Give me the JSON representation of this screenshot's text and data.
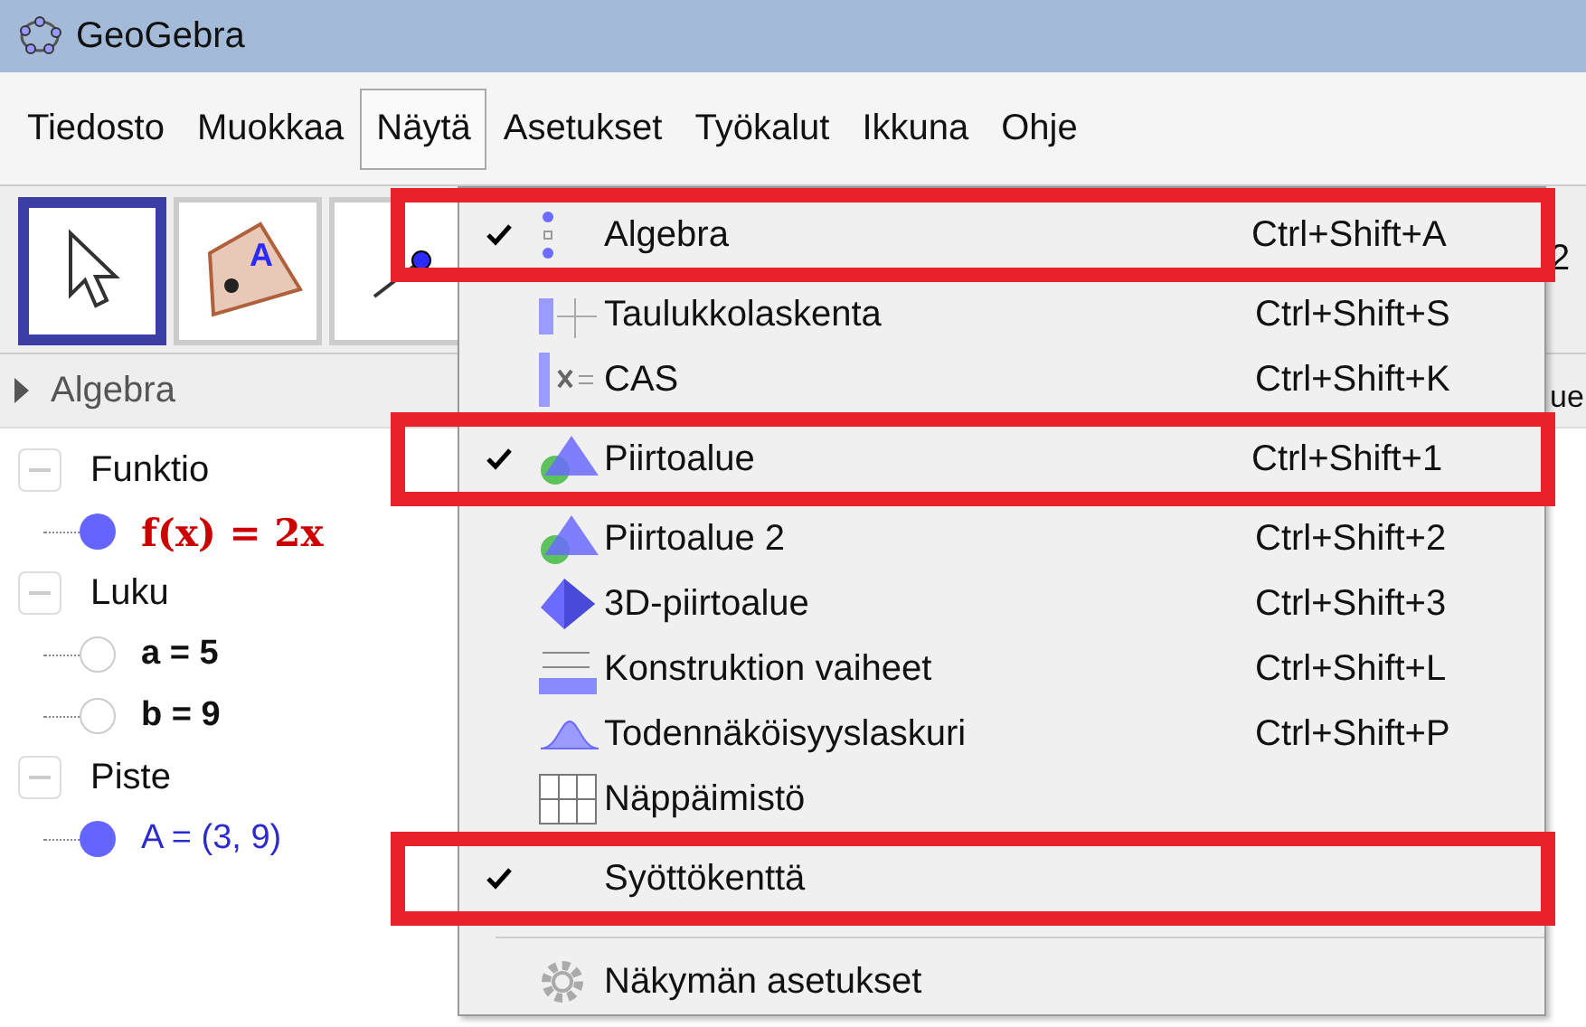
{
  "window": {
    "title": "GeoGebra"
  },
  "menu_bar": [
    {
      "label": "Tiedosto",
      "selected": false
    },
    {
      "label": "Muokkaa",
      "selected": false
    },
    {
      "label": "Näytä",
      "selected": true
    },
    {
      "label": "Asetukset",
      "selected": false
    },
    {
      "label": "Työkalut",
      "selected": false
    },
    {
      "label": "Ikkuna",
      "selected": false
    },
    {
      "label": "Ohje",
      "selected": false
    }
  ],
  "toolbar": {
    "tools": [
      {
        "kind": "move",
        "selected": true
      },
      {
        "kind": "polygon",
        "selected": false,
        "point_label": "A"
      },
      {
        "kind": "line",
        "selected": false
      }
    ]
  },
  "algebra_view": {
    "title": "Algebra",
    "groups": [
      {
        "label": "Funktio",
        "expanded": true,
        "children": [
          {
            "label": "f(x) = 2x",
            "kind": "function",
            "shown": true
          }
        ]
      },
      {
        "label": "Luku",
        "expanded": true,
        "children": [
          {
            "label": "a = 5",
            "kind": "number",
            "shown": false
          },
          {
            "label": "b = 9",
            "kind": "number",
            "shown": false
          }
        ]
      },
      {
        "label": "Piste",
        "expanded": true,
        "children": [
          {
            "label": "A = (3, 9)",
            "kind": "point",
            "shown": true
          }
        ]
      }
    ]
  },
  "right_fragments": [
    "2",
    "ue"
  ],
  "view_menu": {
    "items": [
      {
        "label": "Algebra",
        "shortcut": "Ctrl+Shift+A",
        "checked": true,
        "highlighted": true
      },
      {
        "label": "Taulukkolaskenta",
        "shortcut": "Ctrl+Shift+S",
        "checked": false,
        "highlighted": false
      },
      {
        "label": "CAS",
        "shortcut": "Ctrl+Shift+K",
        "checked": false,
        "highlighted": false
      },
      {
        "label": "Piirtoalue",
        "shortcut": "Ctrl+Shift+1",
        "checked": true,
        "highlighted": true
      },
      {
        "label": "Piirtoalue 2",
        "shortcut": "Ctrl+Shift+2",
        "checked": false,
        "highlighted": false
      },
      {
        "label": "3D-piirtoalue",
        "shortcut": "Ctrl+Shift+3",
        "checked": false,
        "highlighted": false
      },
      {
        "label": "Konstruktion vaiheet",
        "shortcut": "Ctrl+Shift+L",
        "checked": false,
        "highlighted": false
      },
      {
        "label": "Todennäköisyyslaskuri",
        "shortcut": "Ctrl+Shift+P",
        "checked": false,
        "highlighted": false
      },
      {
        "label": "Näppäimistö",
        "checked": false,
        "highlighted": false
      },
      {
        "label": "Syöttökenttä",
        "checked": true,
        "highlighted": true
      }
    ],
    "settings_item": {
      "label": "Näkymän asetukset"
    }
  }
}
